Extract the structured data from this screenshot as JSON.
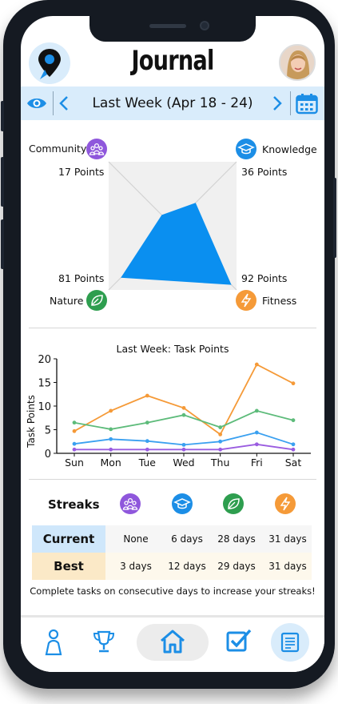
{
  "header": {
    "title": "Journal"
  },
  "week": {
    "label": "Last Week (Apr 18 - 24)"
  },
  "radar": {
    "skills": [
      {
        "name": "Community",
        "points": "17 Points",
        "value": 17,
        "color": "#8f57dc",
        "icon": "community-icon"
      },
      {
        "name": "Knowledge",
        "points": "36 Points",
        "value": 36,
        "color": "#1c8ee6",
        "icon": "graduation-cap-icon"
      },
      {
        "name": "Fitness",
        "points": "92 Points",
        "value": 92,
        "color": "#f59a38",
        "icon": "lightning-icon"
      },
      {
        "name": "Nature",
        "points": "81 Points",
        "value": 81,
        "color": "#2e9e4f",
        "icon": "leaf-icon"
      }
    ],
    "fill_color": "#0a8ff0"
  },
  "chart_data": {
    "type": "line",
    "title": "Last Week: Task Points",
    "xlabel": "",
    "ylabel": "Task Points",
    "categories": [
      "Sun",
      "Mon",
      "Tue",
      "Wed",
      "Thu",
      "Fri",
      "Sat"
    ],
    "ylim": [
      0,
      20
    ],
    "yticks": [
      0,
      5,
      10,
      15,
      20
    ],
    "series": [
      {
        "color": "#f59a38",
        "values": [
          4.7,
          9.0,
          12.2,
          9.6,
          4.0,
          18.8,
          14.8
        ]
      },
      {
        "color": "#5dbb7a",
        "values": [
          6.5,
          5.1,
          6.5,
          8.1,
          5.5,
          9.0,
          7.0
        ]
      },
      {
        "color": "#3aa0f0",
        "values": [
          2.0,
          3.0,
          2.6,
          1.8,
          2.5,
          4.4,
          1.9
        ]
      },
      {
        "color": "#9a5ce0",
        "values": [
          0.8,
          0.8,
          0.8,
          0.8,
          0.8,
          1.9,
          0.8
        ]
      }
    ]
  },
  "streaks": {
    "label": "Streaks",
    "icons": [
      {
        "name": "community-icon",
        "color": "#8f57dc"
      },
      {
        "name": "graduation-cap-icon",
        "color": "#1c8ee6"
      },
      {
        "name": "leaf-icon",
        "color": "#2e9e4f"
      },
      {
        "name": "lightning-icon",
        "color": "#f59a38"
      }
    ],
    "current": {
      "label": "Current",
      "values": [
        "None",
        "6 days",
        "28 days",
        "31 days"
      ],
      "color": "#cfe7fb"
    },
    "best": {
      "label": "Best",
      "values": [
        "3 days",
        "12 days",
        "29 days",
        "31 days"
      ],
      "color": "#fbe9c7"
    },
    "note": "Complete tasks on consecutive days to increase your streaks!"
  },
  "bottom_nav": {
    "items": [
      "profile-icon",
      "trophy-icon",
      "home-icon",
      "checklist-icon",
      "journal-icon"
    ],
    "accent": "#1c8ee6"
  }
}
